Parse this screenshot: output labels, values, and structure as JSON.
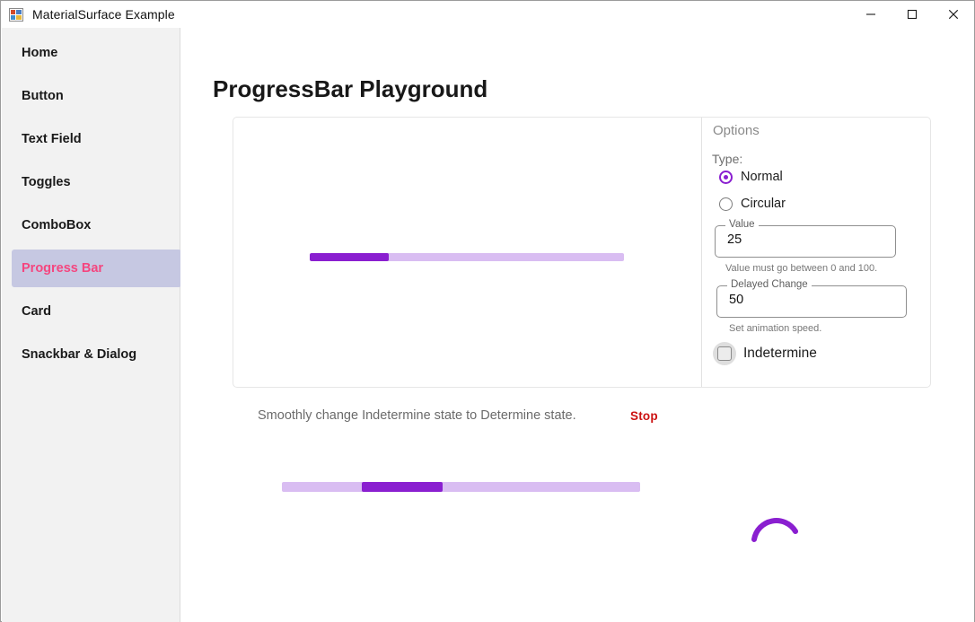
{
  "window": {
    "title": "MaterialSurface Example",
    "icon": "app-window-icon",
    "controls": {
      "minimize": "minimize-icon",
      "maximize": "maximize-icon",
      "close": "close-icon"
    }
  },
  "sidebar": {
    "items": [
      {
        "label": "Home",
        "selected": false
      },
      {
        "label": "Button",
        "selected": false
      },
      {
        "label": "Text Field",
        "selected": false
      },
      {
        "label": "Toggles",
        "selected": false
      },
      {
        "label": "ComboBox",
        "selected": false
      },
      {
        "label": "Progress Bar",
        "selected": true
      },
      {
        "label": "Card",
        "selected": false
      },
      {
        "label": "Snackbar & Dialog",
        "selected": false
      }
    ]
  },
  "page": {
    "title": "ProgressBar Playground"
  },
  "preview": {
    "progress_bar": {
      "value": 25,
      "min": 0,
      "max": 100,
      "fill_color": "#8a1fd0",
      "track_color": "#d9bdf2"
    }
  },
  "options": {
    "title": "Options",
    "type_label": "Type:",
    "radios": [
      {
        "label": "Normal",
        "selected": true
      },
      {
        "label": "Circular",
        "selected": false
      }
    ],
    "value_field": {
      "label": "Value",
      "value": "25",
      "placeholder": "",
      "helper": "Value must go between 0 and 100."
    },
    "delay_field": {
      "label": "Delayed Change",
      "value": "50",
      "placeholder": "",
      "helper": "Set animation speed."
    },
    "checkbox": {
      "label": "Indetermine",
      "checked": false
    }
  },
  "caption": {
    "text": "Smoothly change Indetermine state to Determine state.",
    "stop_label": "Stop",
    "stop_color": "#cc1111"
  },
  "indeterminate_bar": {
    "fill_color": "#8a1fd0",
    "track_color": "#d9bdf2"
  },
  "spinner": {
    "name": "circular-progress-spinner",
    "color": "#8a1fd0"
  }
}
